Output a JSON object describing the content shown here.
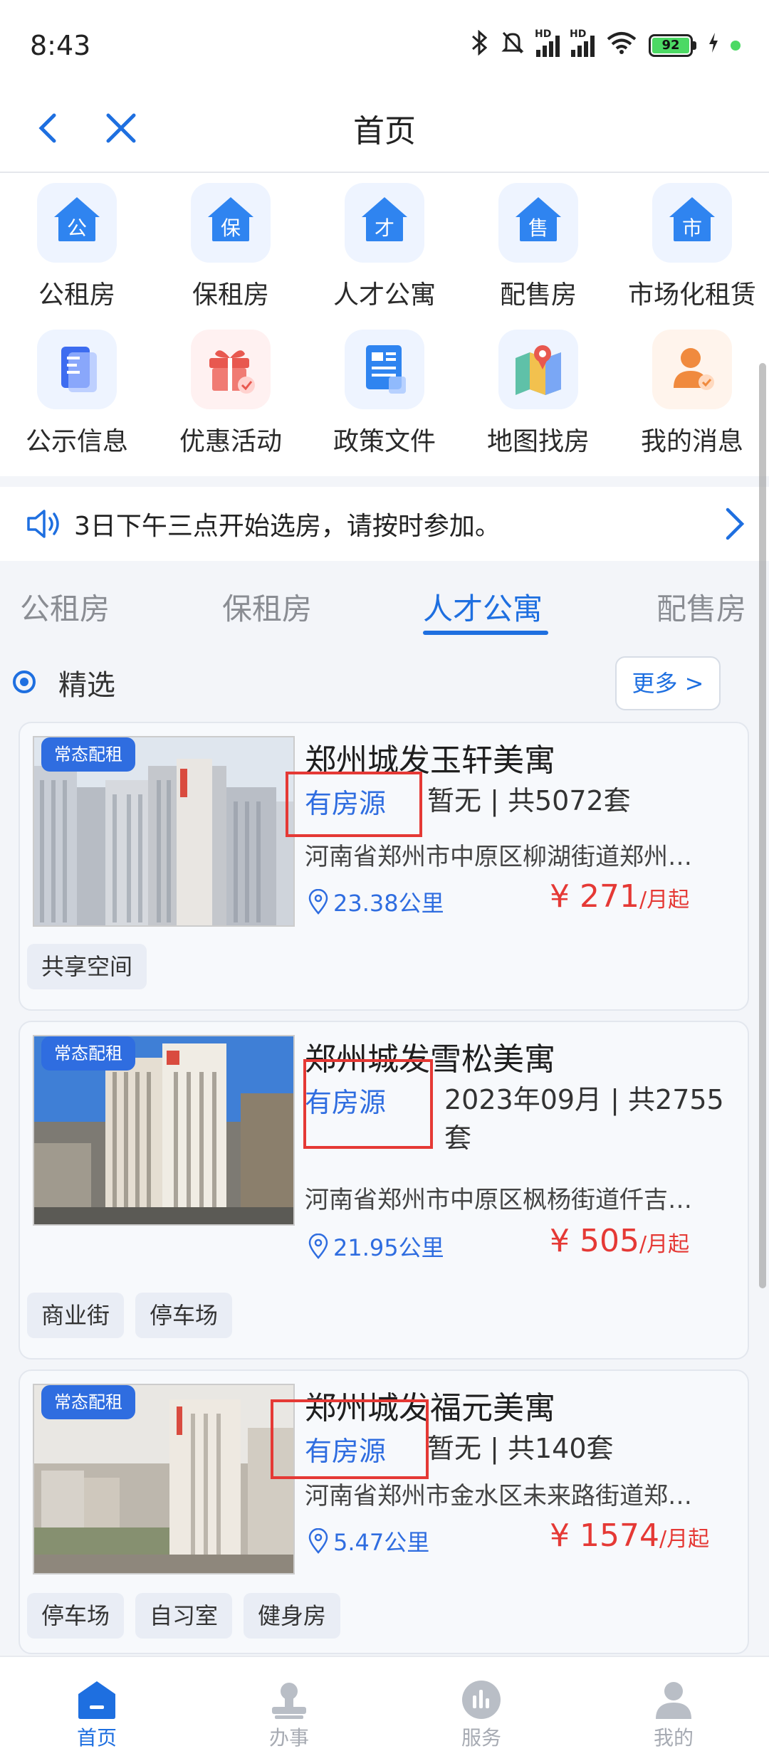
{
  "status_bar": {
    "time": "8:43",
    "battery": "92"
  },
  "nav": {
    "title": "首页"
  },
  "quick_links": [
    {
      "label": "公租房",
      "icon": "gong-house-icon",
      "glyph": "公"
    },
    {
      "label": "保租房",
      "icon": "bao-house-icon",
      "glyph": "保"
    },
    {
      "label": "人才公寓",
      "icon": "cai-house-icon",
      "glyph": "才"
    },
    {
      "label": "配售房",
      "icon": "shou-house-icon",
      "glyph": "售"
    },
    {
      "label": "市场化租赁",
      "icon": "shi-house-icon",
      "glyph": "市"
    },
    {
      "label": "公示信息",
      "icon": "document-icon"
    },
    {
      "label": "优惠活动",
      "icon": "gift-icon"
    },
    {
      "label": "政策文件",
      "icon": "policy-file-icon"
    },
    {
      "label": "地图找房",
      "icon": "map-pin-icon"
    },
    {
      "label": "我的消息",
      "icon": "user-message-icon"
    }
  ],
  "notice": {
    "text": "3日下午三点开始选房，请按时参加。"
  },
  "tabs": [
    "公租房",
    "保租房",
    "人才公寓",
    "配售房"
  ],
  "active_tab": "人才公寓",
  "section": {
    "title": "精选",
    "more": "更多 >"
  },
  "listings": [
    {
      "badge": "常态配租",
      "title": "郑州城发玉轩美寓",
      "status": "有房源",
      "stock": "暂无 | 共5072套",
      "address": "河南省郑州市中原区柳湖街道郑州…",
      "distance": "23.38公里",
      "price": "¥ 271",
      "price_unit": "/月起",
      "tags": [
        "共享空间"
      ]
    },
    {
      "badge": "常态配租",
      "title": "郑州城发雪松美寓",
      "status": "有房源",
      "stock": "2023年09月 | 共2755套",
      "address": "河南省郑州市中原区枫杨街道仟吉…",
      "distance": "21.95公里",
      "price": "¥ 505",
      "price_unit": "/月起",
      "tags": [
        "商业街",
        "停车场"
      ]
    },
    {
      "badge": "常态配租",
      "title": "郑州城发福元美寓",
      "status": "有房源",
      "stock": "暂无 | 共140套",
      "address": "河南省郑州市金水区未来路街道郑…",
      "distance": "5.47公里",
      "price": "¥ 1574",
      "price_unit": "/月起",
      "tags": [
        "停车场",
        "自习室",
        "健身房"
      ]
    }
  ],
  "bottom_nav": [
    {
      "label": "首页",
      "icon": "home-icon",
      "active": true
    },
    {
      "label": "办事",
      "icon": "stamp-icon",
      "active": false
    },
    {
      "label": "服务",
      "icon": "service-icon",
      "active": false
    },
    {
      "label": "我的",
      "icon": "profile-icon",
      "active": false
    }
  ],
  "colors": {
    "accent": "#1e6fe0",
    "price": "#e53935",
    "highlight_box": "#e53935"
  }
}
